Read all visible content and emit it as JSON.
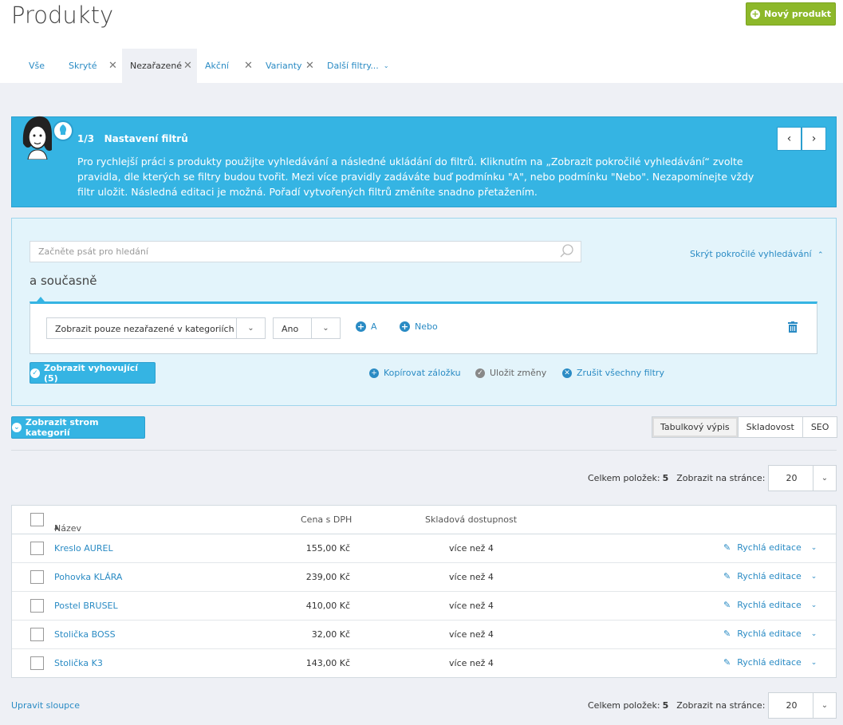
{
  "header": {
    "title": "Produkty",
    "new_button": "Nový produkt"
  },
  "tabs": [
    {
      "label": "Vše"
    },
    {
      "label": "Skryté"
    },
    {
      "label": "Nezařazené"
    },
    {
      "label": "Akční"
    },
    {
      "label": "Varianty"
    },
    {
      "label": "Další filtry..."
    }
  ],
  "guide": {
    "step": "1/3",
    "heading": "Nastavení filtrů",
    "text": "Pro rychlejší práci s produkty použijte vyhledávání a následné ukládání do filtrů. Kliknutím na „Zobrazit pokročilé vyhledávání“ zvolte pravidla, dle kterých se filtry budou tvořit. Mezi více pravidly zadáváte buď podmínku \"A\", nebo podmínku \"Nebo\". Nezapomínejte vždy filtr uložit. Následná editaci je možná. Pořadí vytvořených filtrů změníte snadno přetažením.",
    "prev": "‹",
    "next": "›"
  },
  "search": {
    "placeholder": "Začněte psát pro hledání",
    "hide_advanced": "Skrýt pokročilé vyhledávání",
    "and_now": "a současně",
    "rule_select": "Zobrazit pouze nezařazené v kategoriích",
    "rule_value": "Ano",
    "add_and": "A",
    "add_or": "Nebo",
    "show_matching": "Zobrazit vyhovující (5)",
    "copy_tab": "Kopírovat záložku",
    "save_changes": "Uložit změny",
    "cancel_filters": "Zrušit všechny filtry"
  },
  "toolbar": {
    "tree_button": "Zobrazit strom kategorií",
    "views": [
      "Tabulkový výpis",
      "Skladovost",
      "SEO"
    ]
  },
  "pager": {
    "total_label": "Celkem položek:",
    "total": "5",
    "per_page_label": "Zobrazit na stránce:",
    "per_page": "20"
  },
  "table": {
    "columns": {
      "name": "Název",
      "price": "Cena s DPH",
      "stock": "Skladová dostupnost"
    },
    "rows": [
      {
        "name": "Kreslo AUREL",
        "price": "155,00 Kč",
        "stock": "více než 4",
        "quick": "Rychlá editace"
      },
      {
        "name": "Pohovka KLÁRA",
        "price": "239,00 Kč",
        "stock": "více než 4",
        "quick": "Rychlá editace"
      },
      {
        "name": "Postel BRUSEL",
        "price": "410,00 Kč",
        "stock": "více než 4",
        "quick": "Rychlá editace"
      },
      {
        "name": "Stolička BOSS",
        "price": "32,00 Kč",
        "stock": "více než 4",
        "quick": "Rychlá editace"
      },
      {
        "name": "Stolička K3",
        "price": "143,00 Kč",
        "stock": "více než 4",
        "quick": "Rychlá editace"
      }
    ]
  },
  "footer": {
    "edit_columns": "Upravit sloupce"
  }
}
